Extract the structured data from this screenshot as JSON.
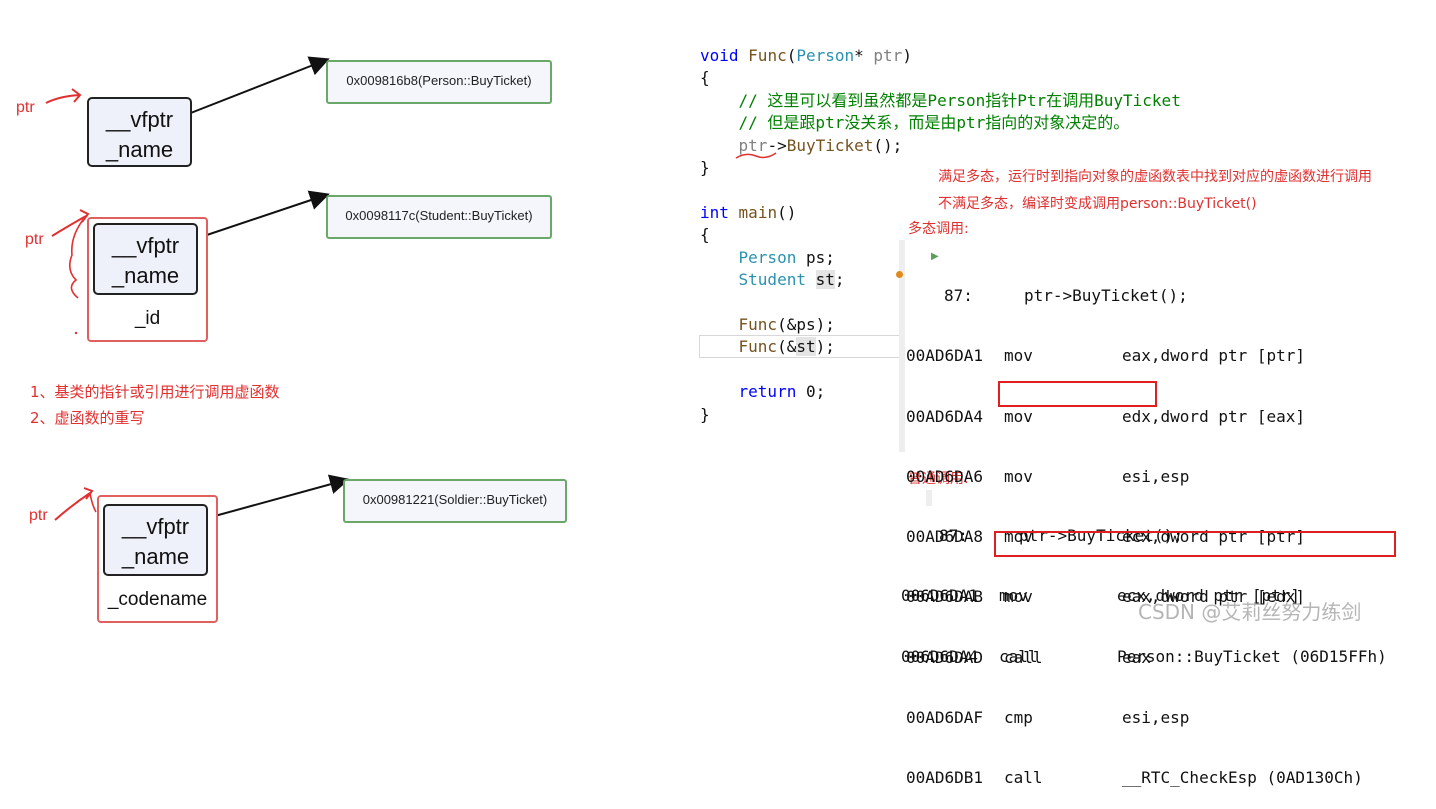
{
  "objects": [
    {
      "ptr": "ptr",
      "fields": [
        "__vfptr",
        "_name"
      ],
      "extra": "",
      "vtable": "0x009816b8(Person::BuyTicket)"
    },
    {
      "ptr": "ptr",
      "fields": [
        "__vfptr",
        "_name"
      ],
      "extra": "_id",
      "vtable": "0x0098117c(Student::BuyTicket)"
    },
    {
      "ptr": "ptr",
      "fields": [
        "__vfptr",
        "_name"
      ],
      "extra": "_codename",
      "vtable": "0x00981221(Soldier::BuyTicket)"
    }
  ],
  "conditions": [
    "1、基类的指针或引用进行调用虚函数",
    "2、虚函数的重写"
  ],
  "code": {
    "line1": {
      "kw": "void",
      "fn": "Func",
      "ty": "Person",
      "rest": "* ",
      "param": "ptr",
      "close": ")"
    },
    "open1": "{",
    "comment1": "// 这里可以看到虽然都是Person指针Ptr在调用BuyTicket",
    "comment2": "// 但是跟ptr没关系，而是由ptr指向的对象决定的。",
    "call": {
      "obj": "ptr",
      "arrow": "->",
      "fn": "BuyTicket",
      "tail": "();"
    },
    "close1": "}",
    "main": {
      "kw": "int",
      "fn": "main",
      "tail": "()"
    },
    "open2": "{",
    "decl1": {
      "ty": "Person",
      "var": "ps;"
    },
    "decl2": {
      "ty": "Student",
      "var": "st",
      "tail": ";"
    },
    "call1": {
      "fn": "Func",
      "a": "(&",
      "v": "ps",
      "b": ");"
    },
    "call2": {
      "fn": "Func",
      "a": "(&",
      "v": "st",
      "b": ");"
    },
    "ret": {
      "kw": "return",
      "tail": " 0;"
    },
    "close2": "}"
  },
  "notes": {
    "poly": "满足多态，运行时到指向对象的虚函数表中找到对应的虚函数进行调用",
    "nonpoly": "不满足多态，编译时变成调用person::BuyTicket()",
    "poly_label": "多态调用:",
    "normal_label": "普通调用:"
  },
  "asm_poly": {
    "source_line": "87:",
    "source_code": "ptr->BuyTicket();",
    "rows": [
      {
        "addr": "00AD6DA1",
        "op": "mov",
        "arg": "eax,dword ptr [ptr]"
      },
      {
        "addr": "00AD6DA4",
        "op": "mov",
        "arg": "edx,dword ptr [eax]"
      },
      {
        "addr": "00AD6DA6",
        "op": "mov",
        "arg": "esi,esp"
      },
      {
        "addr": "00AD6DA8",
        "op": "mov",
        "arg": "ecx,dword ptr [ptr]"
      },
      {
        "addr": "00AD6DAB",
        "op": "mov",
        "arg": "eax,dword ptr [edx]"
      },
      {
        "addr": "00AD6DAD",
        "op": "call",
        "arg": "eax"
      },
      {
        "addr": "00AD6DAF",
        "op": "cmp",
        "arg": "esi,esp"
      },
      {
        "addr": "00AD6DB1",
        "op": "call",
        "arg": "__RTC_CheckEsp (0AD130Ch)"
      }
    ]
  },
  "asm_normal": {
    "source_line": "87:",
    "source_code": "ptr->BuyTicket();",
    "rows": [
      {
        "addr": "006D6DA1",
        "op": "mov",
        "arg": "ecx,dword ptr [ptr]"
      },
      {
        "addr": "006D6DA4",
        "op": "call",
        "arg": "Person::BuyTicket (06D15FFh)"
      }
    ]
  },
  "watermark": "CSDN @艾莉丝努力练剑",
  "colors": {
    "object_border": "#e06060",
    "vtable_border": "#6aa86a",
    "keyword": "#0000ff",
    "type": "#2b91af",
    "comment": "#008000",
    "annotation": "#e03030"
  }
}
